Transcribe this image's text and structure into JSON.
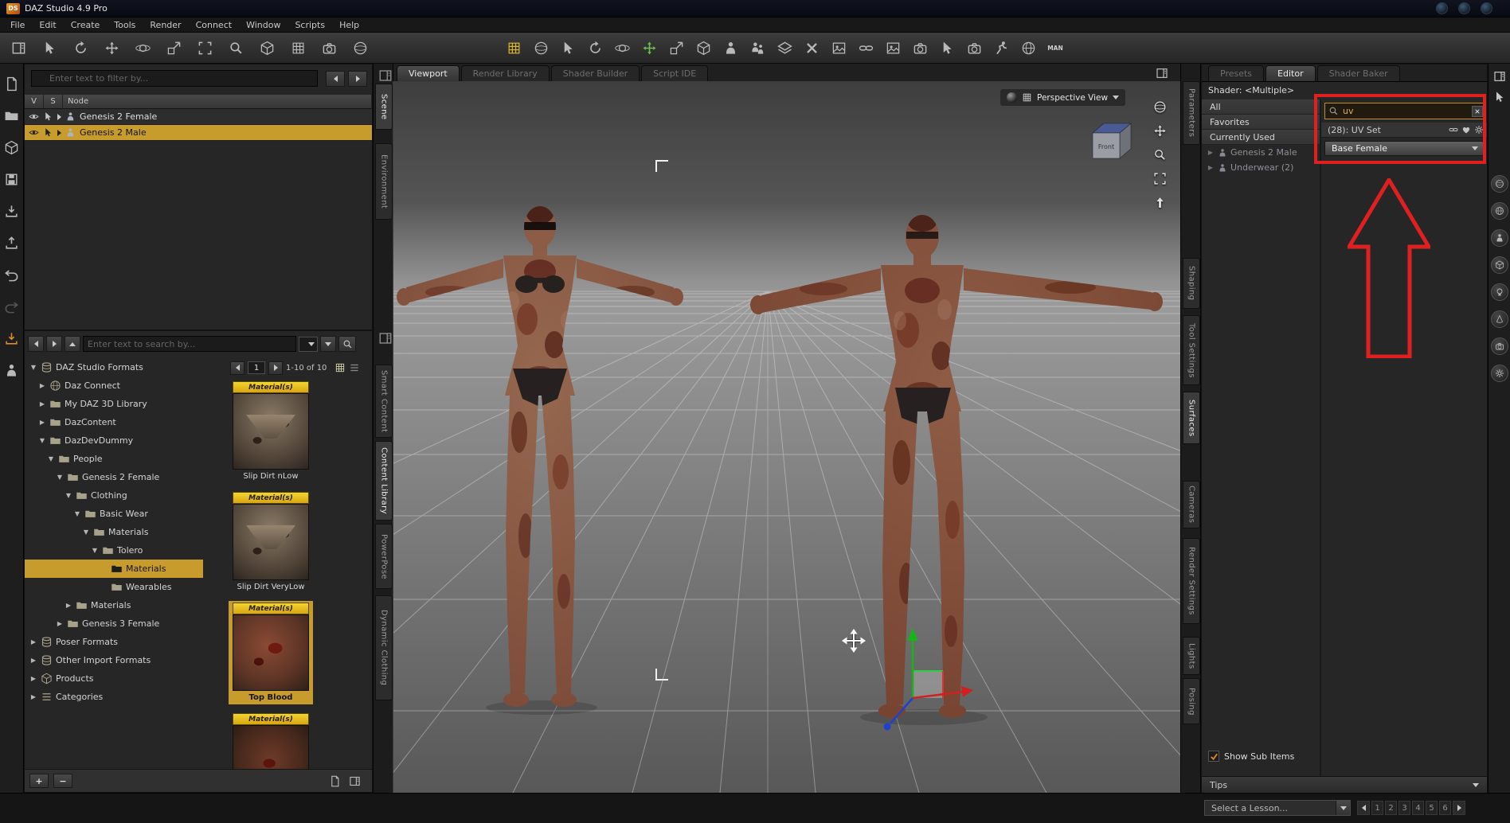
{
  "window": {
    "title": "DAZ Studio 4.9 Pro",
    "logo": "DS"
  },
  "menu": {
    "items": [
      "File",
      "Edit",
      "Create",
      "Tools",
      "Render",
      "Connect",
      "Window",
      "Scripts",
      "Help"
    ]
  },
  "toolbar": {
    "left_icons": [
      {
        "name": "layout-pane-icon",
        "icon": "pane"
      },
      {
        "name": "select-tool-icon",
        "icon": "cursor"
      },
      {
        "name": "rotate-tool-icon",
        "icon": "rotate"
      },
      {
        "name": "pan-tool-icon",
        "icon": "pan"
      },
      {
        "name": "orbit-tool-icon",
        "icon": "orbit"
      },
      {
        "name": "scale-tool-icon",
        "icon": "scale"
      },
      {
        "name": "frame-tool-icon",
        "icon": "frame"
      },
      {
        "name": "aim-tool-icon",
        "icon": "mag"
      },
      {
        "name": "cube-tool-icon",
        "icon": "cube"
      },
      {
        "name": "grid-snap-icon",
        "icon": "grid"
      },
      {
        "name": "camera-tool-icon",
        "icon": "camera"
      },
      {
        "name": "scene-ball-icon",
        "icon": "sphere"
      }
    ],
    "main_icons": [
      {
        "name": "grid-toggle-icon",
        "icon": "grid",
        "tint": "yellow"
      },
      {
        "name": "smart-sphere-icon",
        "icon": "sphere"
      },
      {
        "name": "node-select-icon",
        "icon": "cursor"
      },
      {
        "name": "rotate-icon",
        "icon": "rotate"
      },
      {
        "name": "orbit-icon",
        "icon": "orbit"
      },
      {
        "name": "universal-manipulator-icon",
        "icon": "pan",
        "tint": "green"
      },
      {
        "name": "translate-icon",
        "icon": "scale"
      },
      {
        "name": "primitive-cube-icon",
        "icon": "cube"
      },
      {
        "name": "figure-icon",
        "icon": "person"
      },
      {
        "name": "people-icon",
        "icon": "people"
      },
      {
        "name": "surface-layers-icon",
        "icon": "layers"
      },
      {
        "name": "cut-icon",
        "icon": "x"
      },
      {
        "name": "shader-image-icon",
        "icon": "image"
      },
      {
        "name": "link-icon",
        "icon": "link"
      },
      {
        "name": "image-editor-icon",
        "icon": "image"
      },
      {
        "name": "render-camera-icon",
        "icon": "camera"
      },
      {
        "name": "pointer-icon",
        "icon": "cursor"
      },
      {
        "name": "spot-render-icon",
        "icon": "camera"
      },
      {
        "name": "powerpose-icon",
        "icon": "running"
      },
      {
        "name": "puppeteer-icon",
        "icon": "globe"
      },
      {
        "name": "man-logo-icon",
        "label": "MAN"
      }
    ]
  },
  "activity_bar": {
    "icons": [
      {
        "name": "new-document-icon",
        "icon": "doc"
      },
      {
        "name": "open-folder-icon",
        "icon": "folder"
      },
      {
        "name": "package-icon",
        "icon": "cube"
      },
      {
        "name": "save-icon",
        "icon": "save"
      },
      {
        "name": "import-icon",
        "icon": "import"
      },
      {
        "name": "export-icon",
        "icon": "export"
      },
      {
        "name": "undo-icon",
        "icon": "undo"
      },
      {
        "name": "redo-icon",
        "icon": "redo",
        "tint": "dim"
      },
      {
        "name": "download-update-icon",
        "icon": "import",
        "tint": "orange"
      },
      {
        "name": "figure-anchor-icon",
        "icon": "person"
      }
    ]
  },
  "scene_panel": {
    "filter_placeholder": "Enter text to filter by...",
    "columns": [
      "V",
      "S",
      "Node"
    ],
    "rows": [
      {
        "label": "Genesis 2 Female"
      },
      {
        "label": "Genesis 2 Male",
        "selected": true
      }
    ]
  },
  "content_library": {
    "search_placeholder": "Enter text to search by...",
    "pager": {
      "page": "1",
      "range": "1-10 of 10"
    },
    "tree": [
      {
        "label": "DAZ Studio Formats",
        "depth": 0,
        "arrow": "down",
        "icon": "db"
      },
      {
        "label": "Daz Connect",
        "depth": 1,
        "arrow": "right",
        "icon": "globe"
      },
      {
        "label": "My DAZ 3D Library",
        "depth": 1,
        "arrow": "right",
        "icon": "folder"
      },
      {
        "label": "DazContent",
        "depth": 1,
        "arrow": "right",
        "icon": "folder"
      },
      {
        "label": "DazDevDummy",
        "depth": 1,
        "arrow": "down",
        "icon": "folder"
      },
      {
        "label": "People",
        "depth": 2,
        "arrow": "down",
        "icon": "folder"
      },
      {
        "label": "Genesis 2 Female",
        "depth": 3,
        "arrow": "down",
        "icon": "folder"
      },
      {
        "label": "Clothing",
        "depth": 4,
        "arrow": "down",
        "icon": "folder"
      },
      {
        "label": "Basic Wear",
        "depth": 5,
        "arrow": "down",
        "icon": "folder"
      },
      {
        "label": "Materials",
        "depth": 6,
        "arrow": "down",
        "icon": "folder"
      },
      {
        "label": "Tolero",
        "depth": 7,
        "arrow": "down",
        "icon": "folder"
      },
      {
        "label": "Materials",
        "depth": 8,
        "arrow": "none",
        "icon": "folder",
        "selected": true
      },
      {
        "label": "Wearables",
        "depth": 8,
        "arrow": "none",
        "icon": "folder"
      },
      {
        "label": "Materials",
        "depth": 4,
        "arrow": "right",
        "icon": "folder"
      },
      {
        "label": "Genesis 3 Female",
        "depth": 3,
        "arrow": "right",
        "icon": "folder"
      },
      {
        "label": "Poser Formats",
        "depth": 0,
        "arrow": "right",
        "icon": "db"
      },
      {
        "label": "Other Import Formats",
        "depth": 0,
        "arrow": "right",
        "icon": "db"
      },
      {
        "label": "Products",
        "depth": 0,
        "arrow": "right",
        "icon": "cube"
      },
      {
        "label": "Categories",
        "depth": 0,
        "arrow": "right",
        "icon": "list"
      }
    ],
    "thumbnails": [
      {
        "label": "Slip Dirt nLow",
        "badge": "Material(s)",
        "art": "briefs"
      },
      {
        "label": "Slip Dirt VeryLow",
        "badge": "Material(s)",
        "art": "briefs"
      },
      {
        "label": "Top Blood",
        "badge": "Material(s)",
        "art": "torso",
        "selected": true
      },
      {
        "label": "",
        "badge": "Material(s)",
        "art": "torso2"
      }
    ]
  },
  "dock": {
    "left_top": [
      {
        "label": "Scene",
        "active": true
      },
      {
        "label": "Environment"
      }
    ],
    "left_bottom": [
      {
        "label": "Smart Content"
      },
      {
        "label": "Content Library",
        "active": true
      },
      {
        "label": "PowerPose"
      },
      {
        "label": "Dynamic Clothing"
      }
    ],
    "right": [
      {
        "label": "Parameters"
      },
      {
        "label": "Shaping"
      },
      {
        "label": "Tool Settings"
      },
      {
        "label": "Surfaces",
        "active": true
      },
      {
        "label": "Cameras"
      },
      {
        "label": "Render Settings"
      },
      {
        "label": "Lights"
      },
      {
        "label": "Posing"
      }
    ]
  },
  "viewport": {
    "tabs": [
      {
        "label": "Viewport",
        "active": true
      },
      {
        "label": "Render Library"
      },
      {
        "label": "Shader Builder"
      },
      {
        "label": "Script IDE"
      }
    ],
    "camera_label": "Perspective View",
    "cube_label": "Front",
    "tools": [
      {
        "name": "orbit-ball-icon",
        "icon": "sphere"
      },
      {
        "name": "pan-view-icon",
        "icon": "pan"
      },
      {
        "name": "zoom-view-icon",
        "icon": "mag"
      },
      {
        "name": "frame-view-icon",
        "icon": "frame"
      },
      {
        "name": "reset-view-icon",
        "icon": "arrowup"
      }
    ]
  },
  "surfaces_panel": {
    "tabs": [
      {
        "label": "Presets"
      },
      {
        "label": "Editor",
        "active": true
      },
      {
        "label": "Shader Baker"
      }
    ],
    "shader_label": "Shader: <Multiple>",
    "filters": [
      "All",
      "Favorites",
      "Currently Used"
    ],
    "nodes": [
      {
        "label": "Genesis 2 Male"
      },
      {
        "label": "Underwear (2)"
      }
    ],
    "search_value": "uv",
    "result_row": "(28): UV Set",
    "dropdown_value": "Base Female",
    "show_sub_items_label": "Show Sub Items",
    "tips_label": "Tips"
  },
  "right_bar": {
    "top_icons": [
      {
        "name": "pane-icon",
        "icon": "pane"
      },
      {
        "name": "pointer-icon",
        "icon": "cursor"
      }
    ],
    "round_icons": [
      {
        "name": "camera-ball-icon",
        "icon": "sphere"
      },
      {
        "name": "globe-icon",
        "icon": "globe"
      },
      {
        "name": "figure-icon",
        "icon": "person"
      },
      {
        "name": "primitive-cube-icon",
        "icon": "cube"
      },
      {
        "name": "light-bulb-icon",
        "icon": "bulb"
      },
      {
        "name": "spotlight-cone-icon",
        "icon": "cone"
      },
      {
        "name": "camera-icon",
        "icon": "camera"
      },
      {
        "name": "settings-gear-icon",
        "icon": "gear"
      }
    ]
  },
  "lesson_bar": {
    "placeholder": "Select a Lesson...",
    "pages": [
      "1",
      "2",
      "3",
      "4",
      "5",
      "6"
    ]
  },
  "colors": {
    "selection_yellow": "#c79b2c",
    "annotation_red": "#de2120",
    "badge_yellow": "#e8c41f"
  }
}
